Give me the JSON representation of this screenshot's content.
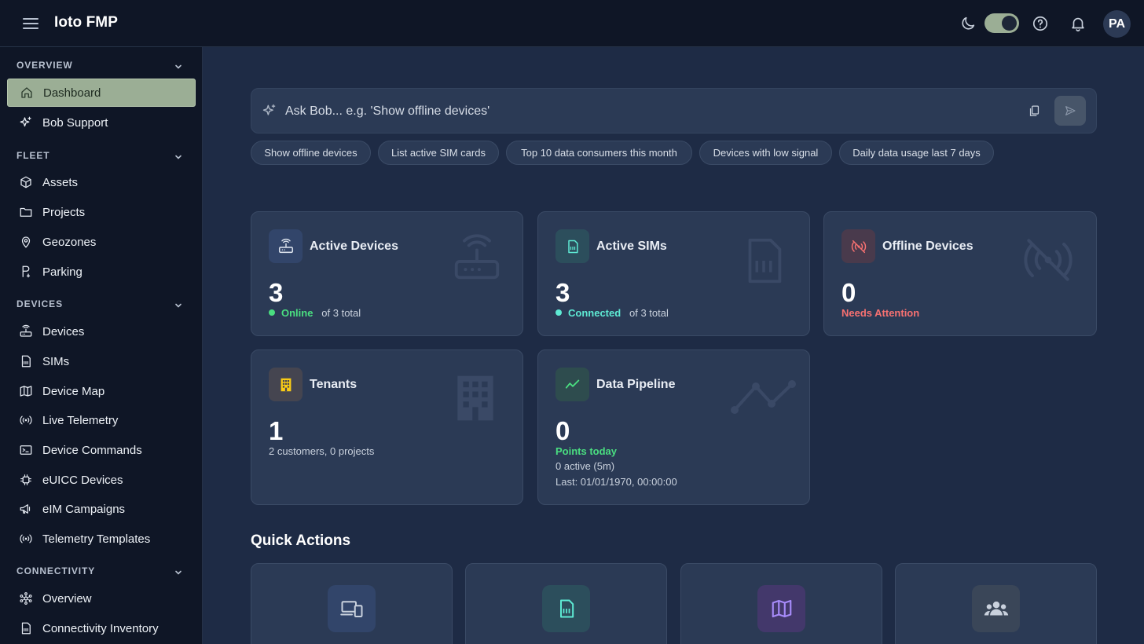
{
  "app": {
    "title": "Ioto FMP",
    "avatar_initials": "PA"
  },
  "sidebar": {
    "sections": [
      {
        "title": "OVERVIEW",
        "items": [
          {
            "label": "Dashboard",
            "icon": "home-icon",
            "active": true
          },
          {
            "label": "Bob Support",
            "icon": "sparkles-icon"
          }
        ]
      },
      {
        "title": "FLEET",
        "items": [
          {
            "label": "Assets",
            "icon": "box-icon"
          },
          {
            "label": "Projects",
            "icon": "folder-icon"
          },
          {
            "label": "Geozones",
            "icon": "map-pin-icon"
          },
          {
            "label": "Parking",
            "icon": "parking-icon"
          }
        ]
      },
      {
        "title": "DEVICES",
        "items": [
          {
            "label": "Devices",
            "icon": "router-icon"
          },
          {
            "label": "SIMs",
            "icon": "sim-card-icon"
          },
          {
            "label": "Device Map",
            "icon": "map-icon"
          },
          {
            "label": "Live Telemetry",
            "icon": "radio-icon"
          },
          {
            "label": "Device Commands",
            "icon": "terminal-icon"
          },
          {
            "label": "eUICC Devices",
            "icon": "chip-icon"
          },
          {
            "label": "eIM Campaigns",
            "icon": "megaphone-icon"
          },
          {
            "label": "Telemetry Templates",
            "icon": "radio-icon"
          }
        ]
      },
      {
        "title": "CONNECTIVITY",
        "items": [
          {
            "label": "Overview",
            "icon": "network-icon"
          },
          {
            "label": "Connectivity Inventory",
            "icon": "sim-card-icon"
          }
        ]
      }
    ]
  },
  "ask": {
    "placeholder": "Ask Bob... e.g. 'Show offline devices'",
    "suggestions": [
      "Show offline devices",
      "List active SIM cards",
      "Top 10 data consumers this month",
      "Devices with low signal",
      "Daily data usage last 7 days"
    ]
  },
  "cards": {
    "active_devices": {
      "title": "Active Devices",
      "value": "3",
      "status": "Online",
      "detail": "of 3 total",
      "status_color": "#4ade80"
    },
    "active_sims": {
      "title": "Active SIMs",
      "value": "3",
      "status": "Connected",
      "detail": "of 3 total",
      "status_color": "#5eead4"
    },
    "offline_devices": {
      "title": "Offline Devices",
      "value": "0",
      "status": "Needs Attention",
      "status_color": "#f87171"
    },
    "tenants": {
      "title": "Tenants",
      "value": "1",
      "detail": "2 customers, 0 projects"
    },
    "data_pipeline": {
      "title": "Data Pipeline",
      "value": "0",
      "status": "Points today",
      "active": "0 active (5m)",
      "last": "Last: 01/01/1970, 00:00:00",
      "status_color": "#4ade80"
    }
  },
  "quick_actions": {
    "title": "Quick Actions",
    "items": [
      {
        "icon": "devices-icon"
      },
      {
        "icon": "sim-card-icon"
      },
      {
        "icon": "map-icon"
      },
      {
        "icon": "users-icon"
      }
    ]
  },
  "colors": {
    "accent": "#9bae95",
    "background": "#1e2b45",
    "sidebar": "#0f1626",
    "card": "#2b3a55"
  }
}
